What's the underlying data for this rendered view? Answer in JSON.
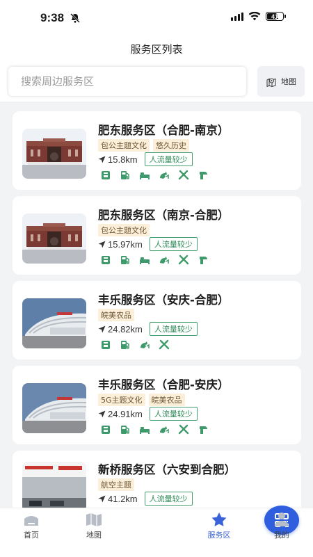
{
  "status": {
    "time": "9:38",
    "battery": "41"
  },
  "header": {
    "title": "服务区列表"
  },
  "search": {
    "placeholder": "搜索周边服务区"
  },
  "map_button": {
    "label": "地图"
  },
  "cards": [
    {
      "name": "肥东服务区（合肥-南京）",
      "tags": [
        "包公主题文化",
        "悠久历史"
      ],
      "distance": "15.8km",
      "traffic": "人流量较少",
      "facilities": [
        "store-icon",
        "gas-icon",
        "bed-icon",
        "charging-icon",
        "repair-icon",
        "toilet-icon"
      ]
    },
    {
      "name": "肥东服务区（南京-合肥）",
      "tags": [
        "包公主题文化"
      ],
      "distance": "15.97km",
      "traffic": "人流量较少",
      "facilities": [
        "store-icon",
        "gas-icon",
        "bed-icon",
        "charging-icon",
        "repair-icon",
        "toilet-icon"
      ]
    },
    {
      "name": "丰乐服务区（安庆-合肥）",
      "tags": [
        "皖美农品"
      ],
      "distance": "24.82km",
      "traffic": "人流量较少",
      "facilities": [
        "store-icon",
        "gas-icon",
        "charging-icon",
        "repair-icon"
      ]
    },
    {
      "name": "丰乐服务区（合肥-安庆）",
      "tags": [
        "5G主题文化",
        "皖美农品"
      ],
      "distance": "24.91km",
      "traffic": "人流量较少",
      "facilities": [
        "store-icon",
        "gas-icon",
        "bed-icon",
        "charging-icon",
        "repair-icon",
        "toilet-icon"
      ]
    },
    {
      "name": "新桥服务区（六安到合肥）",
      "tags": [
        "航空主题"
      ],
      "distance": "41.2km",
      "traffic": "人流量较少",
      "facilities": []
    }
  ],
  "tabbar": [
    {
      "label": "首页",
      "icon": "home-icon"
    },
    {
      "label": "地图",
      "icon": "map-icon"
    },
    {
      "label": "",
      "icon": "scan-icon"
    },
    {
      "label": "服务区",
      "icon": "star-icon"
    },
    {
      "label": "我的",
      "icon": "user-icon"
    }
  ],
  "colors": {
    "accent": "#3b63d9",
    "green": "#3e9a6a",
    "tag_bg": "#fcefd9"
  }
}
